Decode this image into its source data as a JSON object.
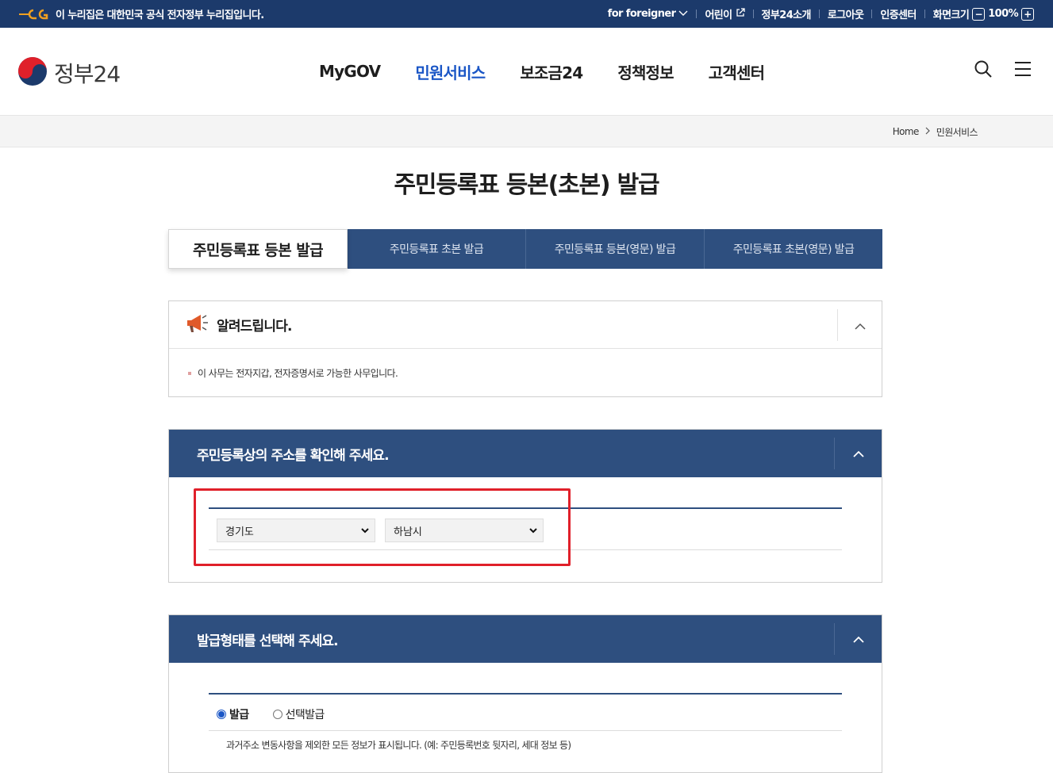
{
  "topbar": {
    "gov_notice": "이 누리집은 대한민국 공식 전자정부 누리집입니다.",
    "links": {
      "foreigner": "for foreigner",
      "kids": "어린이",
      "about": "정부24소개",
      "logout": "로그아웃",
      "cert": "인증센터",
      "screen_size": "화면크기",
      "zoom_value": "100%"
    }
  },
  "header": {
    "logo_text": "정부24",
    "nav": [
      "MyGOV",
      "민원서비스",
      "보조금24",
      "정책정보",
      "고객센터"
    ],
    "active_nav": "민원서비스"
  },
  "breadcrumb": {
    "home": "Home",
    "current": "민원서비스"
  },
  "page": {
    "title": "주민등록표 등본(초본) 발급"
  },
  "tabs": [
    {
      "label": "주민등록표 등본 발급",
      "active": true
    },
    {
      "label": "주민등록표 초본 발급",
      "active": false
    },
    {
      "label": "주민등록표 등본(영문) 발급",
      "active": false
    },
    {
      "label": "주민등록표 초본(영문) 발급",
      "active": false
    }
  ],
  "notice": {
    "title": "알려드립니다.",
    "body": "이 사무는 전자지갑, 전자증명서로 가능한 사무입니다."
  },
  "address_section": {
    "title": "주민등록상의 주소를 확인해 주세요.",
    "province": "경기도",
    "city": "하남시"
  },
  "issue_section": {
    "title": "발급형태를 선택해 주세요.",
    "options": [
      "발급",
      "선택발급"
    ],
    "selected": "발급",
    "description": "과거주소 변동사항을 제외한 모든 정보가 표시됩니다. (예: 주민등록번호 뒷자리, 세대 정보 등)"
  },
  "colors": {
    "topbar": "#1c3a6b",
    "section_header": "#2e4f7f",
    "active_nav": "#1a56c6",
    "highlight": "#e0202a"
  }
}
